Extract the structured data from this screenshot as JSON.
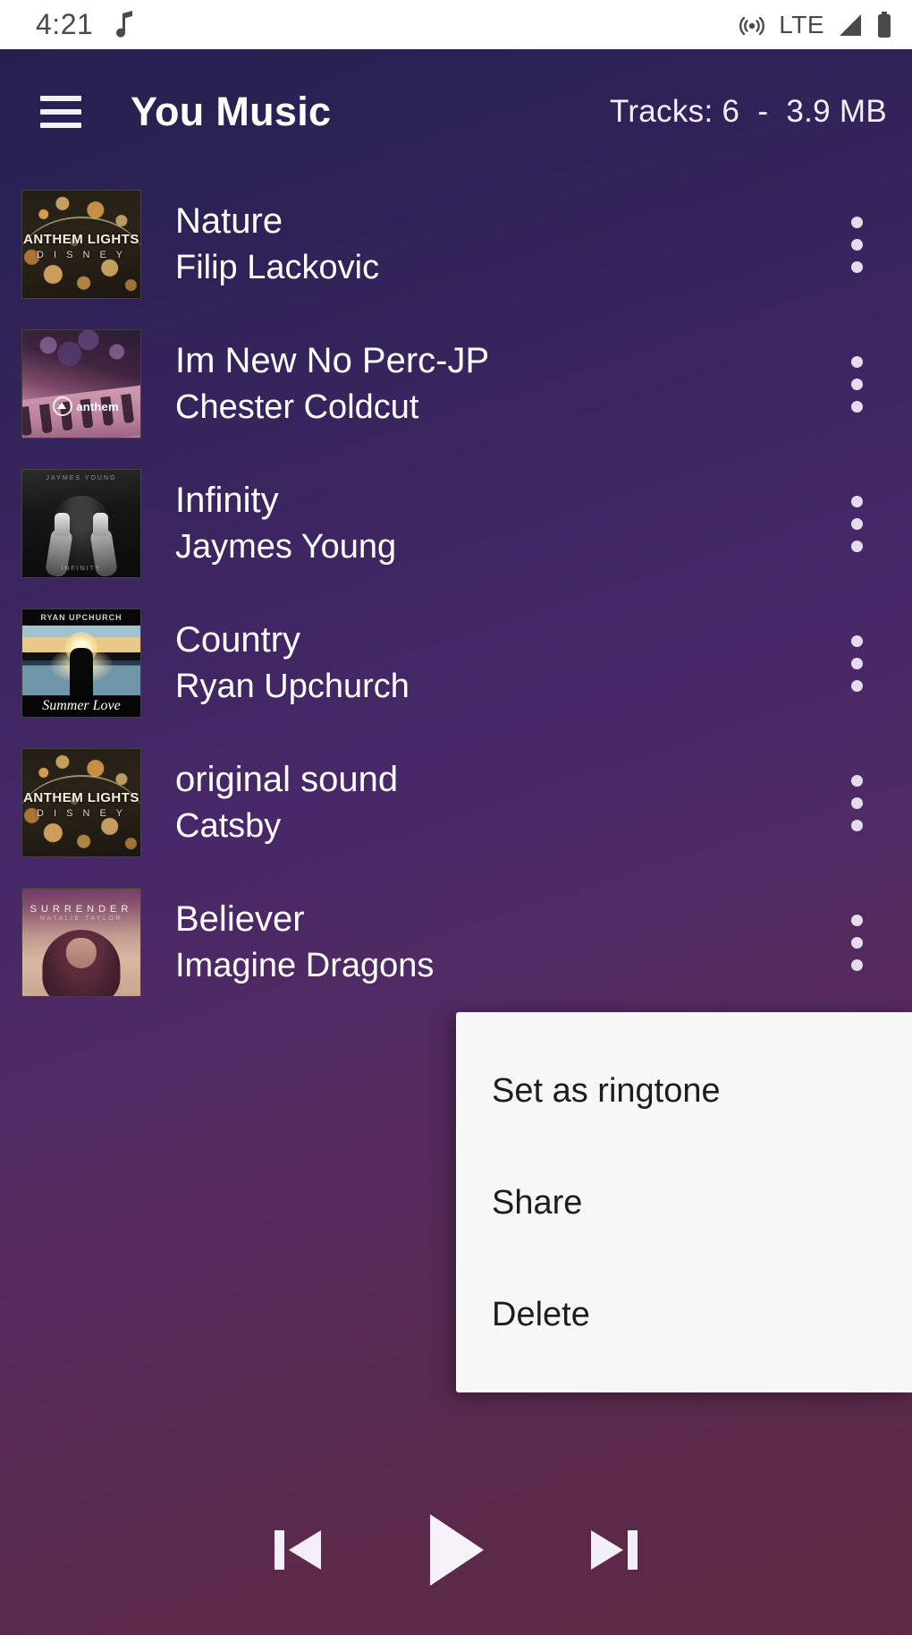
{
  "status_bar": {
    "time": "4:21",
    "left_icons": [
      "music-note-icon"
    ],
    "network_label": "LTE",
    "right_icons": [
      "hotspot-icon",
      "signal-icon",
      "battery-icon"
    ],
    "background": "#ffffff",
    "foreground": "#4a4a4a"
  },
  "app_bar": {
    "menu_icon": "hamburger-menu-icon",
    "title": "You Music",
    "stats": "Tracks: 6  -  3.9 MB"
  },
  "theme": {
    "gradient_top": "#262050",
    "gradient_bottom": "#5e2a43",
    "text_primary": "#ffffff",
    "menu_background": "#f7f7f7",
    "menu_text": "#1d1d1d"
  },
  "tracks": [
    {
      "title": "Nature",
      "artist": "Filip Lackovic",
      "artwork": "anthem-lights-disney",
      "artwork_text": {
        "main": "ANTHEM LIGHTS",
        "sub": "D I S N E Y"
      },
      "overflow_icon": "more-vertical-icon"
    },
    {
      "title": "Im New No Perc-JP",
      "artist": "Chester Coldcut",
      "artwork": "anthem-keyboard",
      "artwork_text": {
        "main": "anthem"
      },
      "overflow_icon": "more-vertical-icon"
    },
    {
      "title": "Infinity",
      "artist": "Jaymes Young",
      "artwork": "jaymes-young-infinity",
      "artwork_text": {
        "main": "JAYMES YOUNG",
        "sub": "INFINITY"
      },
      "overflow_icon": "more-vertical-icon"
    },
    {
      "title": "Country",
      "artist": "Ryan Upchurch",
      "artwork": "ryan-upchurch-summer-love",
      "artwork_text": {
        "main": "RYAN UPCHURCH",
        "sub": "Summer Love"
      },
      "overflow_icon": "more-vertical-icon"
    },
    {
      "title": "original sound",
      "artist": "Catsby",
      "artwork": "anthem-lights-disney",
      "artwork_text": {
        "main": "ANTHEM LIGHTS",
        "sub": "D I S N E Y"
      },
      "overflow_icon": "more-vertical-icon"
    },
    {
      "title": "Believer",
      "artist": "Imagine Dragons",
      "artwork": "surrender",
      "artwork_text": {
        "main": "SURRENDER",
        "sub": "NATALIE TAYLOR"
      },
      "overflow_icon": "more-vertical-icon"
    }
  ],
  "context_menu": {
    "visible": true,
    "items": [
      {
        "label": "Set as ringtone"
      },
      {
        "label": "Share"
      },
      {
        "label": "Delete"
      }
    ]
  },
  "player_controls": [
    {
      "name": "previous",
      "icon": "skip-previous-icon"
    },
    {
      "name": "play",
      "icon": "play-icon"
    },
    {
      "name": "next",
      "icon": "skip-next-icon"
    }
  ]
}
